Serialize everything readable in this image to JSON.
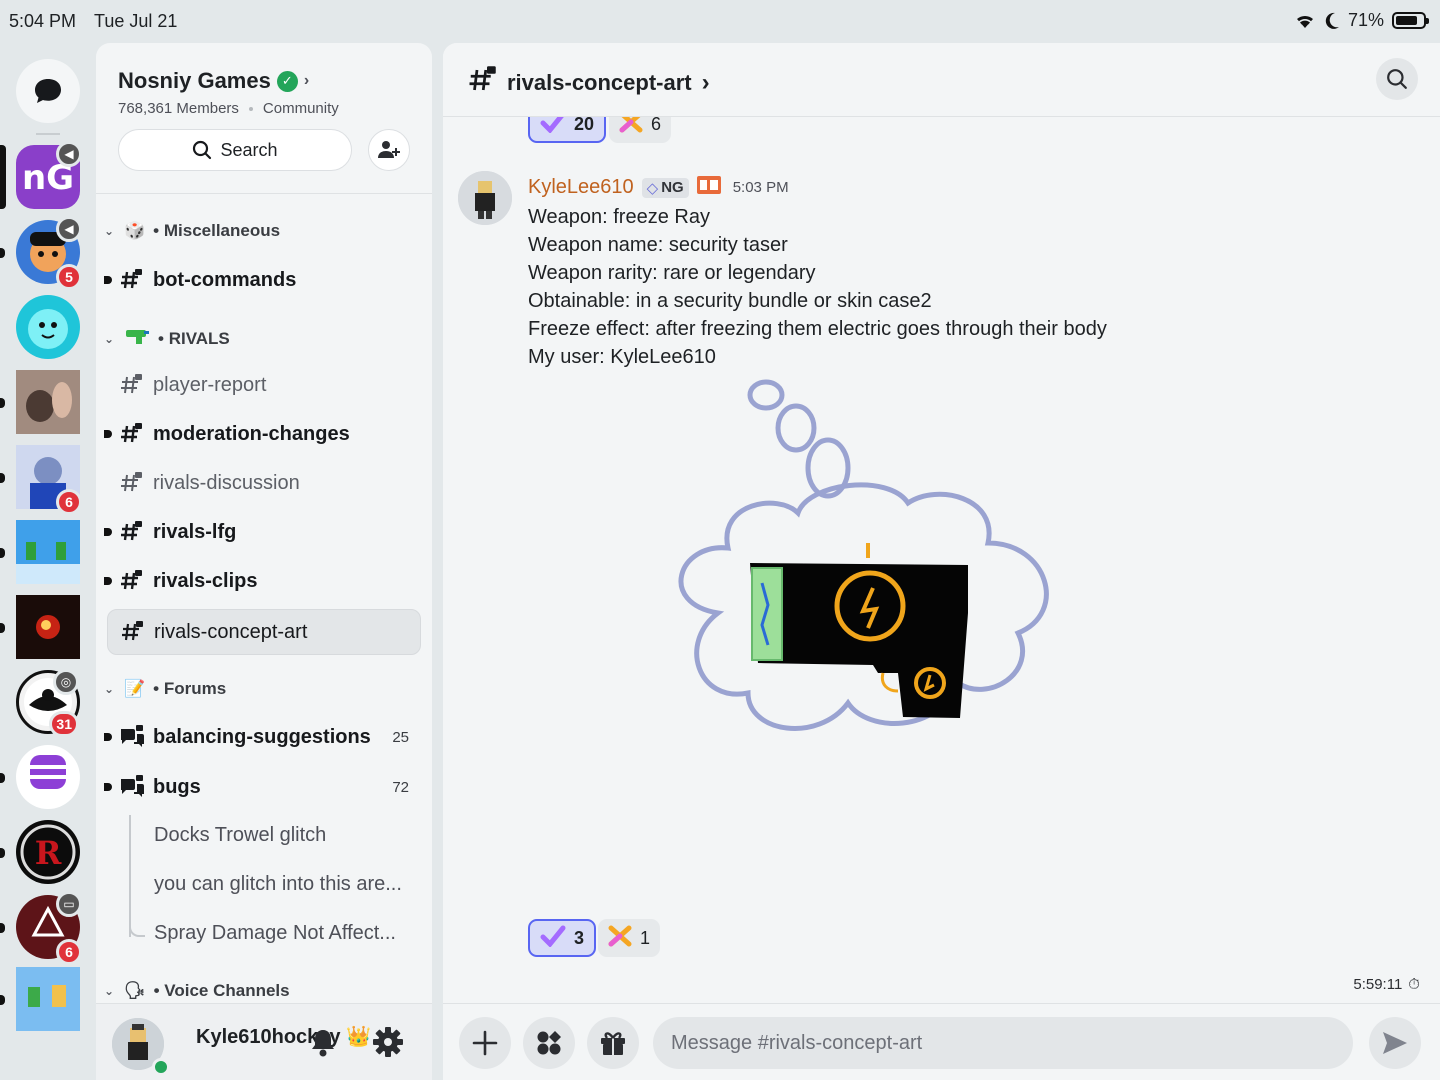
{
  "status_bar": {
    "time": "5:04 PM",
    "date": "Tue Jul 21",
    "battery": "71%"
  },
  "server_rail": {
    "badges": {
      "server2": "5",
      "server5": "6",
      "server8": "31",
      "server11": "6"
    }
  },
  "server": {
    "name": "Nosniy Games",
    "members": "768,361 Members",
    "type": "Community",
    "search_label": "Search"
  },
  "sidebar": {
    "categories": {
      "misc": "Miscellaneous",
      "rivals": "RIVALS",
      "forums": "Forums",
      "voice": "Voice Channels"
    },
    "channels": {
      "bot_commands": "bot-commands",
      "player_report": "player-report",
      "moderation_changes": "moderation-changes",
      "rivals_discussion": "rivals-discussion",
      "rivals_lfg": "rivals-lfg",
      "rivals_clips": "rivals-clips",
      "rivals_concept_art": "rivals-concept-art",
      "balancing_suggestions": "balancing-suggestions",
      "balancing_count": "25",
      "bugs": "bugs",
      "bugs_count": "72"
    },
    "threads": [
      "Docks Trowel glitch",
      "you can glitch into this are...",
      "Spray Damage Not Affect..."
    ]
  },
  "user": {
    "name": "Kyle610hockey"
  },
  "chat": {
    "channel_title": "rivals-concept-art",
    "prev_reactions": {
      "check_count": "20",
      "cross_count": "6"
    },
    "message": {
      "author": "KyleLee610",
      "tag": "NG",
      "time": "5:03 PM",
      "lines": [
        "Weapon: freeze Ray",
        "Weapon name: security taser",
        "Weapon rarity: rare or legendary",
        "Obtainable: in a security bundle or skin case2",
        "Freeze effect: after freezing them electric goes through their body",
        "My user: KyleLee610"
      ],
      "reactions": {
        "check_count": "3",
        "cross_count": "1"
      }
    },
    "voice_timer": "5:59:11",
    "composer_placeholder": "Message #rivals-concept-art"
  },
  "colors": {
    "accent": "#5865f2",
    "online": "#23a55a",
    "mention": "#e0323a",
    "author": "#c0621f"
  }
}
